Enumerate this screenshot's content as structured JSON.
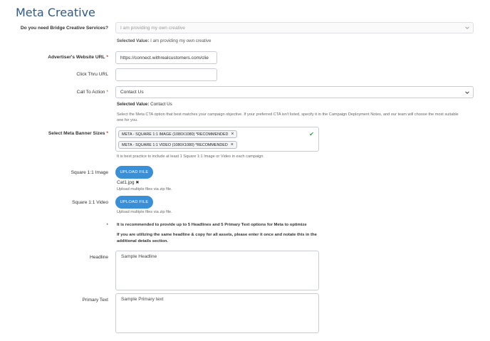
{
  "page": {
    "title": "Meta Creative"
  },
  "creative_services": {
    "label": "Do you need Bridge Creative Services?",
    "value": "I am providing my own creative",
    "selected_prefix": "Selected Value:",
    "selected_value": "I am providing my own creative"
  },
  "website_url": {
    "label": "Advertiser's Website URL",
    "required": "*",
    "value": "https://connect.withrealcustomers.com/clie"
  },
  "click_thru": {
    "label": "Click Thru URL",
    "value": ""
  },
  "cta": {
    "label": "Call To Action",
    "required": "*",
    "value": "Contact Us",
    "selected_prefix": "Selected Value:",
    "selected_value": "Contact Us",
    "help_line1": "Select the Meta CTA option that best matches your campaign objective. If your preferred CTA isn't listed, specify it in the Campaign Deployment Notes, and our team will choose the most suitable",
    "help_line2": "one for you."
  },
  "banner_sizes": {
    "label": "Select Meta Banner Sizes",
    "required": "*",
    "tags": [
      "META - SQUARE 1:1 IMAGE (1080X1080) *RECOMMENDED",
      "META - SQUARE 1:1 VIDEO (1080X1080) *RECOMMENDED"
    ],
    "remove_glyph": "×",
    "check_glyph": "✔",
    "hint": "It is best practice to include at least 1 Square 1:1 Image or Video in each campaign"
  },
  "square_image": {
    "label": "Square 1:1 Image",
    "button": "UPLOAD FILE",
    "file_name": "Cat1.jpg",
    "file_remove": "✖",
    "hint": "Upload multiple files via zip file."
  },
  "square_video": {
    "label": "Square 1:1 Video",
    "button": "UPLOAD FILE",
    "hint": "Upload multiple files via zip file."
  },
  "recommendation": {
    "marker": "*",
    "line1": "It is recommended to provide up to 5 Headlines and 5 Primary Text options for Meta to optimize",
    "line2": "If you are utilizing the same headline & copy for all assets, please enter it once and notate this in the",
    "line3": "additional details section."
  },
  "headline": {
    "label": "Headline",
    "value": "Sample Headline"
  },
  "primary_text": {
    "label": "Primary Text",
    "value": "Sample Primary text"
  },
  "colors": {
    "title": "#2f5a8a",
    "button": "#3a8fd6",
    "required": "#c0392b",
    "check": "#2e9b3a"
  }
}
